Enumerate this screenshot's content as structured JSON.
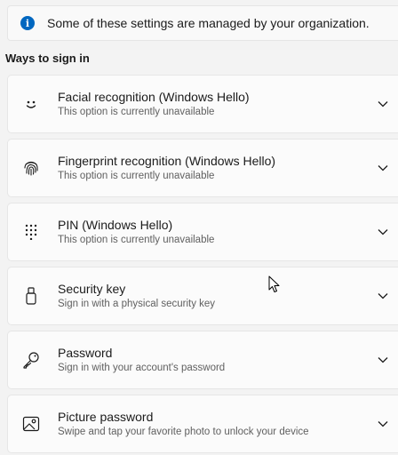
{
  "banner": {
    "icon": "info-icon",
    "text": "Some of these settings are managed by your organization."
  },
  "section_title": "Ways to sign in",
  "items": [
    {
      "icon": "smile-icon",
      "title": "Facial recognition (Windows Hello)",
      "subtitle": "This option is currently unavailable"
    },
    {
      "icon": "fingerprint-icon",
      "title": "Fingerprint recognition (Windows Hello)",
      "subtitle": "This option is currently unavailable"
    },
    {
      "icon": "keypad-icon",
      "title": "PIN (Windows Hello)",
      "subtitle": "This option is currently unavailable"
    },
    {
      "icon": "usb-key-icon",
      "title": "Security key",
      "subtitle": "Sign in with a physical security key"
    },
    {
      "icon": "key-icon",
      "title": "Password",
      "subtitle": "Sign in with your account's password"
    },
    {
      "icon": "picture-icon",
      "title": "Picture password",
      "subtitle": "Swipe and tap your favorite photo to unlock your device"
    }
  ],
  "colors": {
    "accent": "#0067c0",
    "background": "#f3f3f3",
    "card": "#fbfbfb"
  }
}
